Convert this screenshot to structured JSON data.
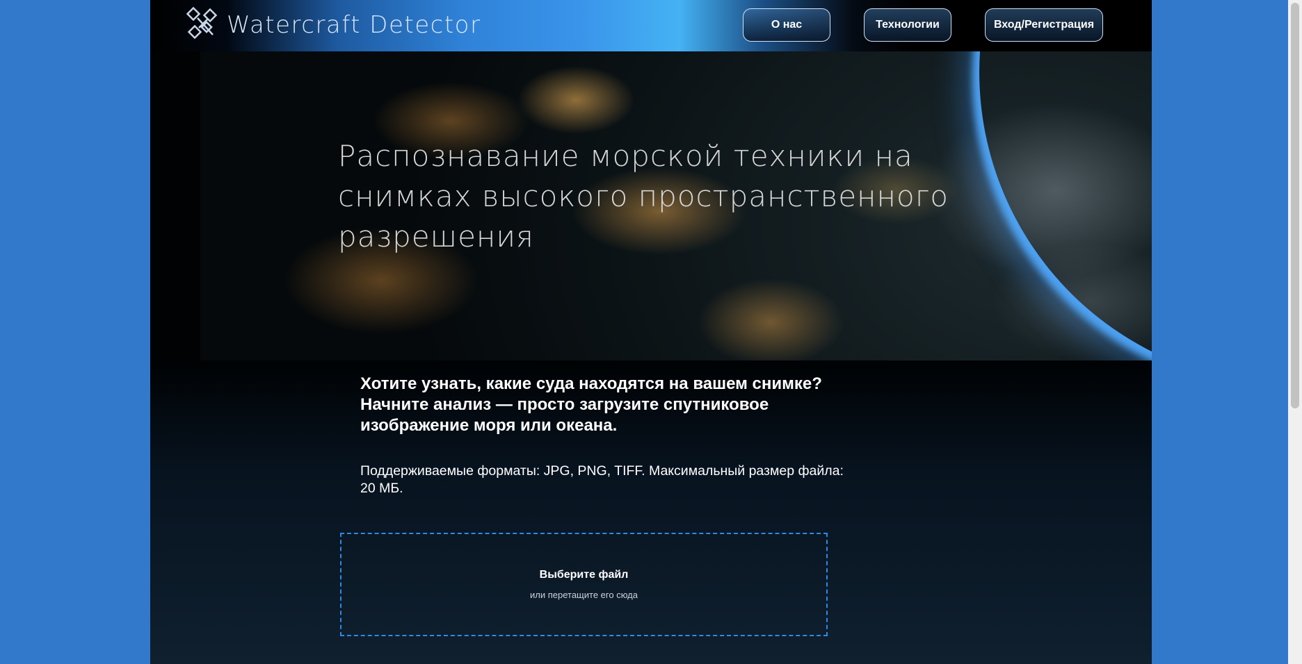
{
  "header": {
    "logo_text": "Watercraft Detector",
    "logo_icon": "satellite-icon",
    "nav": {
      "about": "О нас",
      "technologies": "Технологии",
      "login": "Вход/Регистрация"
    }
  },
  "hero": {
    "title": "Распознавание морской техники на снимках высокого пространственного разрешения"
  },
  "main": {
    "lead": "Хотите узнать, какие суда находятся на вашем снимке? Начните анализ — просто загрузите спутниковое изображение моря или океана.",
    "formats": "Поддерживаемые форматы: JPG, PNG, TIFF. Максимальный размер файла: 20 МБ."
  },
  "upload": {
    "choose_label": "Выберите файл",
    "drag_hint": "или перетащите его сюда"
  },
  "colors": {
    "page_bg": "#3279cc",
    "accent": "#2a8bea",
    "content_bg": "#000204"
  }
}
